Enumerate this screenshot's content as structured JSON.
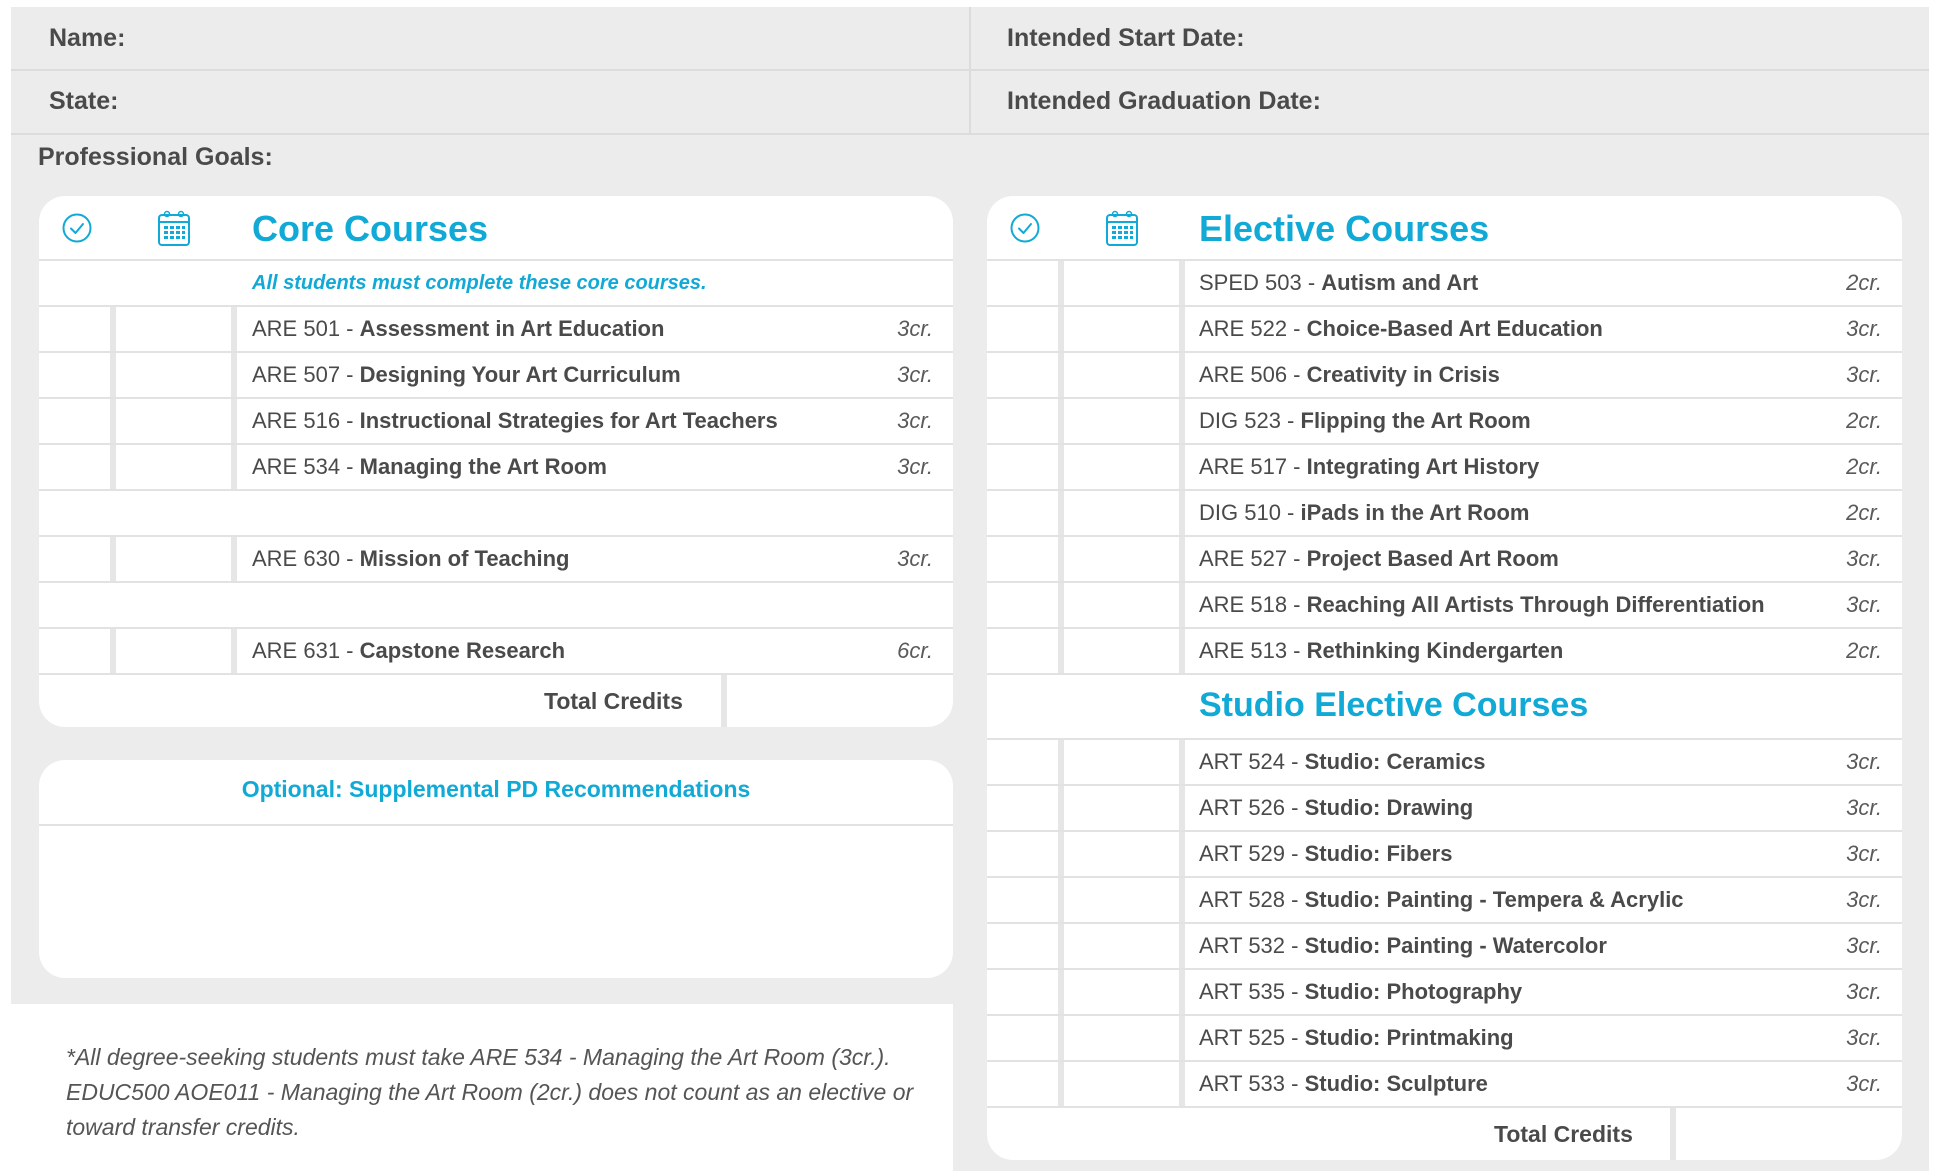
{
  "header": {
    "name_label": "Name:",
    "start_label": "Intended Start Date:",
    "state_label": "State:",
    "grad_label": "Intended Graduation Date:",
    "goals_label": "Professional Goals:"
  },
  "colors": {
    "accent": "#11a9d6",
    "panel": "#ececec",
    "text": "#4a4a4a"
  },
  "icons": {
    "check": "check-circle-icon",
    "calendar": "calendar-icon"
  },
  "core": {
    "title": "Core Courses",
    "note": "All students must complete these core courses.",
    "rows": [
      {
        "code": "ARE 501",
        "name": "Assessment in Art Education",
        "cr": "3cr."
      },
      {
        "code": "ARE 507",
        "name": "Designing Your Art Curriculum",
        "cr": "3cr."
      },
      {
        "code": "ARE 516",
        "name": "Instructional Strategies for Art Teachers",
        "cr": "3cr."
      },
      {
        "code": "ARE 534",
        "name": "Managing the Art Room",
        "cr": "3cr."
      },
      {
        "code": "ARE 630",
        "name": "Mission of Teaching",
        "cr": "3cr."
      },
      {
        "code": "ARE 631",
        "name": "Capstone Research",
        "cr": "6cr."
      }
    ],
    "total_label": "Total Credits"
  },
  "optional": {
    "title": "Optional: Supplemental PD Recommendations"
  },
  "elective": {
    "title": "Elective Courses",
    "rows": [
      {
        "code": "SPED 503",
        "name": "Autism and Art",
        "cr": "2cr."
      },
      {
        "code": "ARE 522",
        "name": "Choice-Based Art Education",
        "cr": "3cr."
      },
      {
        "code": "ARE 506",
        "name": "Creativity in Crisis",
        "cr": "3cr."
      },
      {
        "code": "DIG 523",
        "name": "Flipping the Art Room",
        "cr": "2cr."
      },
      {
        "code": "ARE 517",
        "name": "Integrating Art History",
        "cr": "2cr."
      },
      {
        "code": "DIG 510",
        "name": "iPads in the Art Room",
        "cr": "2cr."
      },
      {
        "code": "ARE 527",
        "name": "Project Based Art Room",
        "cr": "3cr."
      },
      {
        "code": "ARE 518",
        "name": "Reaching All Artists Through Differentiation",
        "cr": "3cr."
      },
      {
        "code": "ARE 513",
        "name": "Rethinking Kindergarten",
        "cr": "2cr."
      }
    ]
  },
  "studio": {
    "title": "Studio Elective Courses",
    "rows": [
      {
        "code": "ART 524",
        "name": "Studio: Ceramics",
        "cr": "3cr."
      },
      {
        "code": "ART 526",
        "name": "Studio: Drawing",
        "cr": "3cr."
      },
      {
        "code": "ART 529",
        "name": "Studio: Fibers",
        "cr": "3cr."
      },
      {
        "code": "ART 528",
        "name": "Studio: Painting - Tempera & Acrylic",
        "cr": "3cr."
      },
      {
        "code": "ART 532",
        "name": "Studio: Painting - Watercolor",
        "cr": "3cr."
      },
      {
        "code": "ART 535",
        "name": "Studio: Photography",
        "cr": "3cr."
      },
      {
        "code": "ART 525",
        "name": "Studio: Printmaking",
        "cr": "3cr."
      },
      {
        "code": "ART 533",
        "name": "Studio: Sculpture",
        "cr": "3cr."
      }
    ],
    "total_label": "Total Credits"
  },
  "footnote": "*All degree-seeking students must take ARE 534 - Managing the Art Room (3cr.). EDUC500 AOE011 - Managing the Art Room (2cr.) does not count as an elective or toward transfer credits."
}
